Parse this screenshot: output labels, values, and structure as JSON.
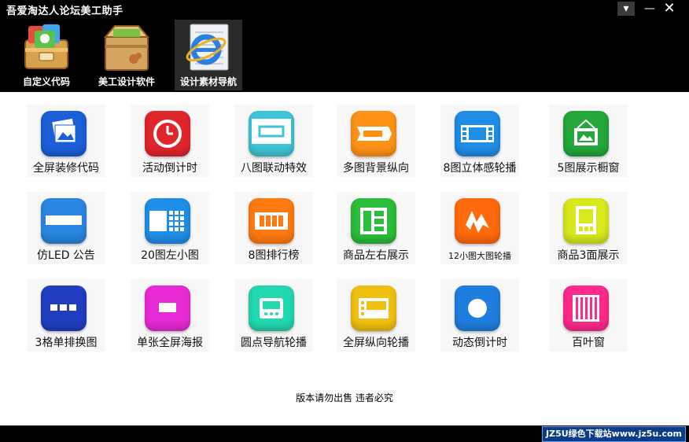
{
  "window": {
    "title": "吾爱淘达人论坛美工助手",
    "dropdown_glyph": "▾",
    "minimize_glyph": "—",
    "close_glyph": "✕"
  },
  "toolbar": {
    "items": [
      {
        "label": "自定义代码",
        "icon": "code-box-icon"
      },
      {
        "label": "美工设计软件",
        "icon": "software-box-icon"
      },
      {
        "label": "设计素材导航",
        "icon": "ie-browser-icon",
        "active": true
      }
    ]
  },
  "tiles": [
    {
      "label": "全屏装修代码",
      "color": "#1a5fd8",
      "icon": "photo-stack-icon"
    },
    {
      "label": "活动倒计时",
      "color": "#e0262b",
      "icon": "clock-icon"
    },
    {
      "label": "八图联动特效",
      "color": "#3ec4d8",
      "icon": "frame-icon"
    },
    {
      "label": "多图背景纵向",
      "color": "#ff9216",
      "icon": "arrow-banner-icon"
    },
    {
      "label": "8图立体感轮播",
      "color": "#1f8ee8",
      "icon": "film-strip-icon"
    },
    {
      "label": "5图展示橱窗",
      "color": "#22a83a",
      "icon": "hanging-picture-icon"
    },
    {
      "label": "仿LED 公告",
      "color": "#2a86e0",
      "icon": "led-bar-icon"
    },
    {
      "label": "20图左小图",
      "color": "#1f8ee8",
      "icon": "grid-icon"
    },
    {
      "label": "8图排行榜",
      "color": "#ff7a10",
      "icon": "bars-icon"
    },
    {
      "label": "商品左右展示",
      "color": "#2bbd3b",
      "icon": "split-layout-icon"
    },
    {
      "label": "12小图大图轮播",
      "color": "#ff6a0a",
      "icon": "lightning-icon"
    },
    {
      "label": "商品3面展示",
      "color": "#d8e81c",
      "icon": "panel-icon"
    },
    {
      "label": "3格单排换图",
      "color": "#1f3fc0",
      "icon": "three-cell-icon"
    },
    {
      "label": "单张全屏海报",
      "color": "#e82ad6",
      "icon": "poster-icon"
    },
    {
      "label": "圆点导航轮播",
      "color": "#22d8b0",
      "icon": "dots-nav-icon"
    },
    {
      "label": "全屏纵向轮播",
      "color": "#f0c010",
      "icon": "vertical-carousel-icon"
    },
    {
      "label": "动态倒计时",
      "color": "#1f7fe0",
      "icon": "circle-icon"
    },
    {
      "label": "百叶窗",
      "color": "#ff2a8c",
      "icon": "blinds-icon"
    }
  ],
  "footer": {
    "note": "版本请勿出售 违者必究"
  },
  "watermark": {
    "text": "JZ5U绿色下载站www.jz5u.com"
  }
}
